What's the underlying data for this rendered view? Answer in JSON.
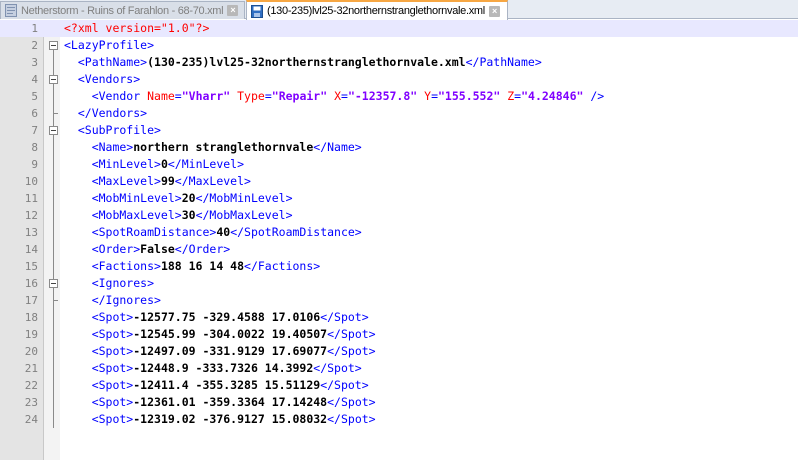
{
  "tabs": [
    {
      "label": "Netherstorm - Ruins of Farahlon - 68-70.xml",
      "active": false
    },
    {
      "label": "(130-235)lvl25-32northernstranglethornvale.xml",
      "active": true
    }
  ],
  "close_glyph": "×",
  "lines": [
    {
      "n": "1",
      "parts": [
        [
          "pi",
          "<?xml version=\"1.0\"?>"
        ]
      ]
    },
    {
      "n": "2",
      "parts": [
        [
          "tg",
          "<LazyProfile>"
        ]
      ]
    },
    {
      "n": "3",
      "parts": [
        [
          "tg",
          "  <PathName>"
        ],
        [
          "tx",
          "(130-235)lvl25-32northernstranglethornvale.xml"
        ],
        [
          "tg",
          "</PathName>"
        ]
      ]
    },
    {
      "n": "4",
      "parts": [
        [
          "tg",
          "  <Vendors>"
        ]
      ]
    },
    {
      "n": "5",
      "parts": [
        [
          "tg",
          "    <Vendor "
        ],
        [
          "an",
          "Name"
        ],
        [
          "tg",
          "="
        ],
        [
          "av",
          "\"Vharr\""
        ],
        [
          "an",
          " Type"
        ],
        [
          "tg",
          "="
        ],
        [
          "av",
          "\"Repair\""
        ],
        [
          "an",
          " X"
        ],
        [
          "tg",
          "="
        ],
        [
          "av",
          "\"-12357.8\""
        ],
        [
          "an",
          " Y"
        ],
        [
          "tg",
          "="
        ],
        [
          "av",
          "\"155.552\""
        ],
        [
          "an",
          " Z"
        ],
        [
          "tg",
          "="
        ],
        [
          "av",
          "\"4.24846\""
        ],
        [
          "tg",
          " />"
        ]
      ]
    },
    {
      "n": "6",
      "parts": [
        [
          "tg",
          "  </Vendors>"
        ]
      ]
    },
    {
      "n": "7",
      "parts": [
        [
          "tg",
          "  <SubProfile>"
        ]
      ]
    },
    {
      "n": "8",
      "parts": [
        [
          "tg",
          "    <Name>"
        ],
        [
          "tx",
          "northern stranglethornvale"
        ],
        [
          "tg",
          "</Name>"
        ]
      ]
    },
    {
      "n": "9",
      "parts": [
        [
          "tg",
          "    <MinLevel>"
        ],
        [
          "tx",
          "0"
        ],
        [
          "tg",
          "</MinLevel>"
        ]
      ]
    },
    {
      "n": "10",
      "parts": [
        [
          "tg",
          "    <MaxLevel>"
        ],
        [
          "tx",
          "99"
        ],
        [
          "tg",
          "</MaxLevel>"
        ]
      ]
    },
    {
      "n": "11",
      "parts": [
        [
          "tg",
          "    <MobMinLevel>"
        ],
        [
          "tx",
          "20"
        ],
        [
          "tg",
          "</MobMinLevel>"
        ]
      ]
    },
    {
      "n": "12",
      "parts": [
        [
          "tg",
          "    <MobMaxLevel>"
        ],
        [
          "tx",
          "30"
        ],
        [
          "tg",
          "</MobMaxLevel>"
        ]
      ]
    },
    {
      "n": "13",
      "parts": [
        [
          "tg",
          "    <SpotRoamDistance>"
        ],
        [
          "tx",
          "40"
        ],
        [
          "tg",
          "</SpotRoamDistance>"
        ]
      ]
    },
    {
      "n": "14",
      "parts": [
        [
          "tg",
          "    <Order>"
        ],
        [
          "tx",
          "False"
        ],
        [
          "tg",
          "</Order>"
        ]
      ]
    },
    {
      "n": "15",
      "parts": [
        [
          "tg",
          "    <Factions>"
        ],
        [
          "tx",
          "188 16 14 48"
        ],
        [
          "tg",
          "</Factions>"
        ]
      ]
    },
    {
      "n": "16",
      "parts": [
        [
          "tg",
          "    <Ignores>"
        ]
      ]
    },
    {
      "n": "17",
      "parts": [
        [
          "tg",
          "    </Ignores>"
        ]
      ]
    },
    {
      "n": "18",
      "parts": [
        [
          "tg",
          "    <Spot>"
        ],
        [
          "tx",
          "-12577.75 -329.4588 17.0106"
        ],
        [
          "tg",
          "</Spot>"
        ]
      ]
    },
    {
      "n": "19",
      "parts": [
        [
          "tg",
          "    <Spot>"
        ],
        [
          "tx",
          "-12545.99 -304.0022 19.40507"
        ],
        [
          "tg",
          "</Spot>"
        ]
      ]
    },
    {
      "n": "20",
      "parts": [
        [
          "tg",
          "    <Spot>"
        ],
        [
          "tx",
          "-12497.09 -331.9129 17.69077"
        ],
        [
          "tg",
          "</Spot>"
        ]
      ]
    },
    {
      "n": "21",
      "parts": [
        [
          "tg",
          "    <Spot>"
        ],
        [
          "tx",
          "-12448.9 -333.7326 14.3992"
        ],
        [
          "tg",
          "</Spot>"
        ]
      ]
    },
    {
      "n": "22",
      "parts": [
        [
          "tg",
          "    <Spot>"
        ],
        [
          "tx",
          "-12411.4 -355.3285 15.51129"
        ],
        [
          "tg",
          "</Spot>"
        ]
      ]
    },
    {
      "n": "23",
      "parts": [
        [
          "tg",
          "    <Spot>"
        ],
        [
          "tx",
          "-12361.01 -359.3364 17.14248"
        ],
        [
          "tg",
          "</Spot>"
        ]
      ]
    },
    {
      "n": "24",
      "parts": [
        [
          "tg",
          "    <Spot>"
        ],
        [
          "tx",
          "-12319.02 -376.9127 15.08032"
        ],
        [
          "tg",
          "</Spot>"
        ]
      ]
    }
  ],
  "fold_markers": {
    "2": "box",
    "4": "box",
    "7": "box",
    "16": "box",
    "6": "tick",
    "17": "tick"
  }
}
